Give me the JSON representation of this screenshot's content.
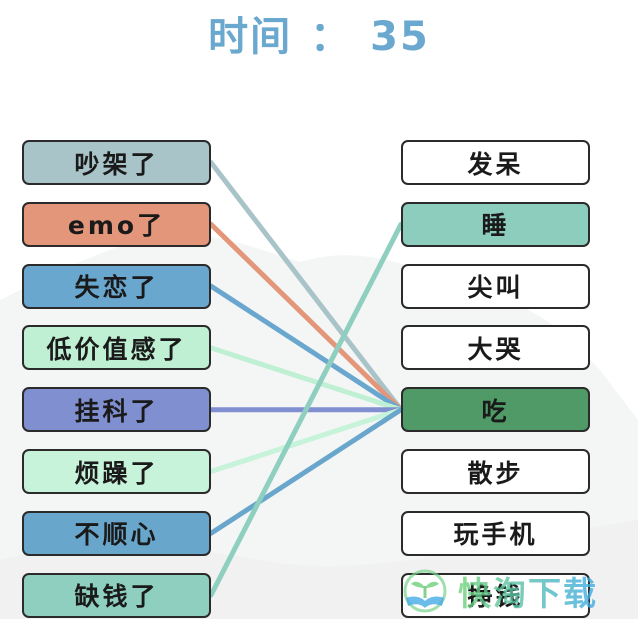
{
  "timer": {
    "label": "时间",
    "separator": "：",
    "value": "35"
  },
  "left_items": [
    {
      "label": "吵架了",
      "color": "#a9c4c9"
    },
    {
      "label": "emo了",
      "color": "#e3967a"
    },
    {
      "label": "失恋了",
      "color": "#6aa7cf"
    },
    {
      "label": "低价值感了",
      "color": "#bff0d4"
    },
    {
      "label": "挂科了",
      "color": "#7f8fcf"
    },
    {
      "label": "烦躁了",
      "color": "#c6f3d9"
    },
    {
      "label": "不顺心",
      "color": "#69a6cc"
    },
    {
      "label": "缺钱了",
      "color": "#8fcfbf"
    }
  ],
  "right_items": [
    {
      "label": "发呆",
      "color": "#ffffff"
    },
    {
      "label": "睡",
      "color": "#8ccdbd"
    },
    {
      "label": "尖叫",
      "color": "#ffffff"
    },
    {
      "label": "大哭",
      "color": "#ffffff"
    },
    {
      "label": "吃",
      "color": "#4f9a67"
    },
    {
      "label": "散步",
      "color": "#ffffff"
    },
    {
      "label": "玩手机",
      "color": "#ffffff"
    },
    {
      "label": "挣钱",
      "color": "#ffffff"
    }
  ],
  "connections": [
    {
      "from": 0,
      "to": 4
    },
    {
      "from": 1,
      "to": 4
    },
    {
      "from": 2,
      "to": 4
    },
    {
      "from": 3,
      "to": 4
    },
    {
      "from": 4,
      "to": 4
    },
    {
      "from": 5,
      "to": 4
    },
    {
      "from": 6,
      "to": 4
    },
    {
      "from": 7,
      "to": 1
    }
  ],
  "watermark": {
    "text": "快淘下载"
  }
}
